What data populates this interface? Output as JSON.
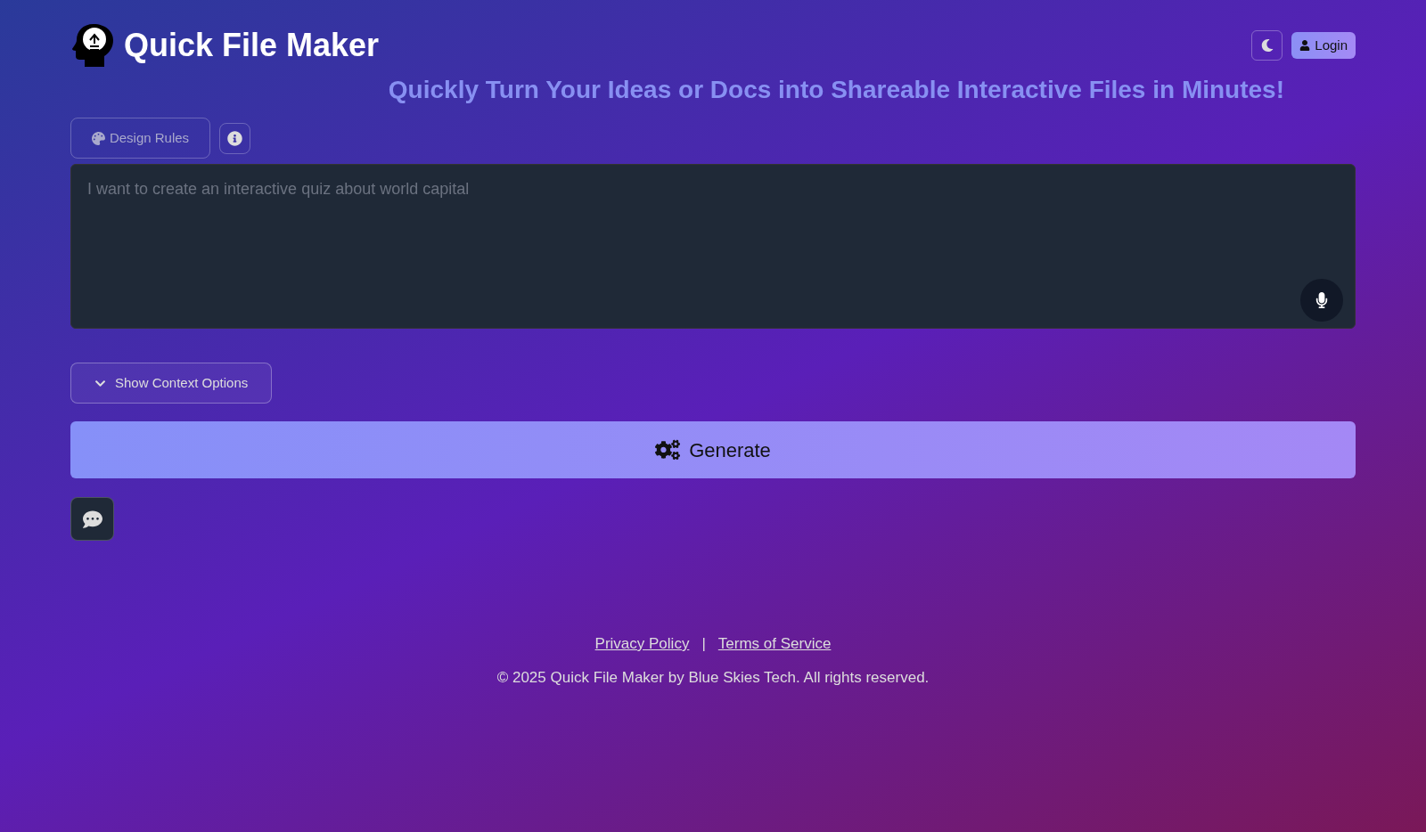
{
  "header": {
    "title": "Quick File Maker",
    "login_label": "Login"
  },
  "tagline": "Quickly Turn Your Ideas or Docs into Shareable Interactive Files in Minutes!",
  "design_rules": {
    "label": "Design Rules"
  },
  "prompt": {
    "placeholder": "I want to create an interactive quiz about world capital"
  },
  "context_toggle": {
    "label": "Show Context Options",
    "expanded": false
  },
  "generate": {
    "label": "Generate"
  },
  "footer": {
    "links": [
      {
        "label": "Privacy Policy"
      },
      {
        "label": "Terms of Service"
      }
    ],
    "separator": "|",
    "copyright": "© 2025 Quick File Maker by Blue Skies Tech. All rights reserved."
  }
}
